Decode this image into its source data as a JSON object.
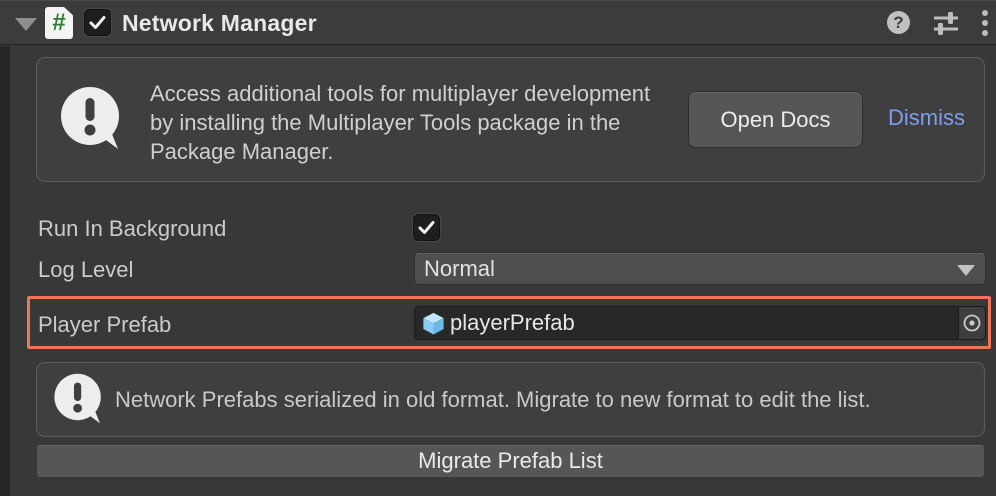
{
  "header": {
    "title": "Network Manager",
    "enabled": true,
    "icons": [
      "foldout-arrow-icon",
      "csharp-script-icon",
      "help-icon",
      "presets-icon",
      "more-menu-icon"
    ]
  },
  "banner": {
    "icon": "info-bubble-icon",
    "text": "Access additional tools for multiplayer development by installing the Multiplayer Tools package in the Package Manager.",
    "open_docs": "Open Docs",
    "dismiss": "Dismiss"
  },
  "fields": {
    "run_in_background": {
      "label": "Run In Background",
      "checked": true
    },
    "log_level": {
      "label": "Log Level",
      "value": "Normal"
    },
    "player_prefab": {
      "label": "Player Prefab",
      "value": "playerPrefab",
      "icon": "prefab-cube-icon",
      "highlighted": true
    }
  },
  "warning": {
    "icon": "info-bubble-icon",
    "text": "Network Prefabs serialized in old format. Migrate to new format to edit the list."
  },
  "footer": {
    "migrate_button": "Migrate Prefab List"
  },
  "colors": {
    "panel_bg": "#383838",
    "header_bg": "#3c3c3c",
    "helpbox_bg": "#3f3f3f",
    "field_bg": "#282828",
    "button_bg": "#565656",
    "highlight_border": "#f0745a",
    "dismiss_link": "#7c9ff0",
    "prefab_icon_blue": "#7fc9f2",
    "script_icon_green": "#2e7d32"
  }
}
